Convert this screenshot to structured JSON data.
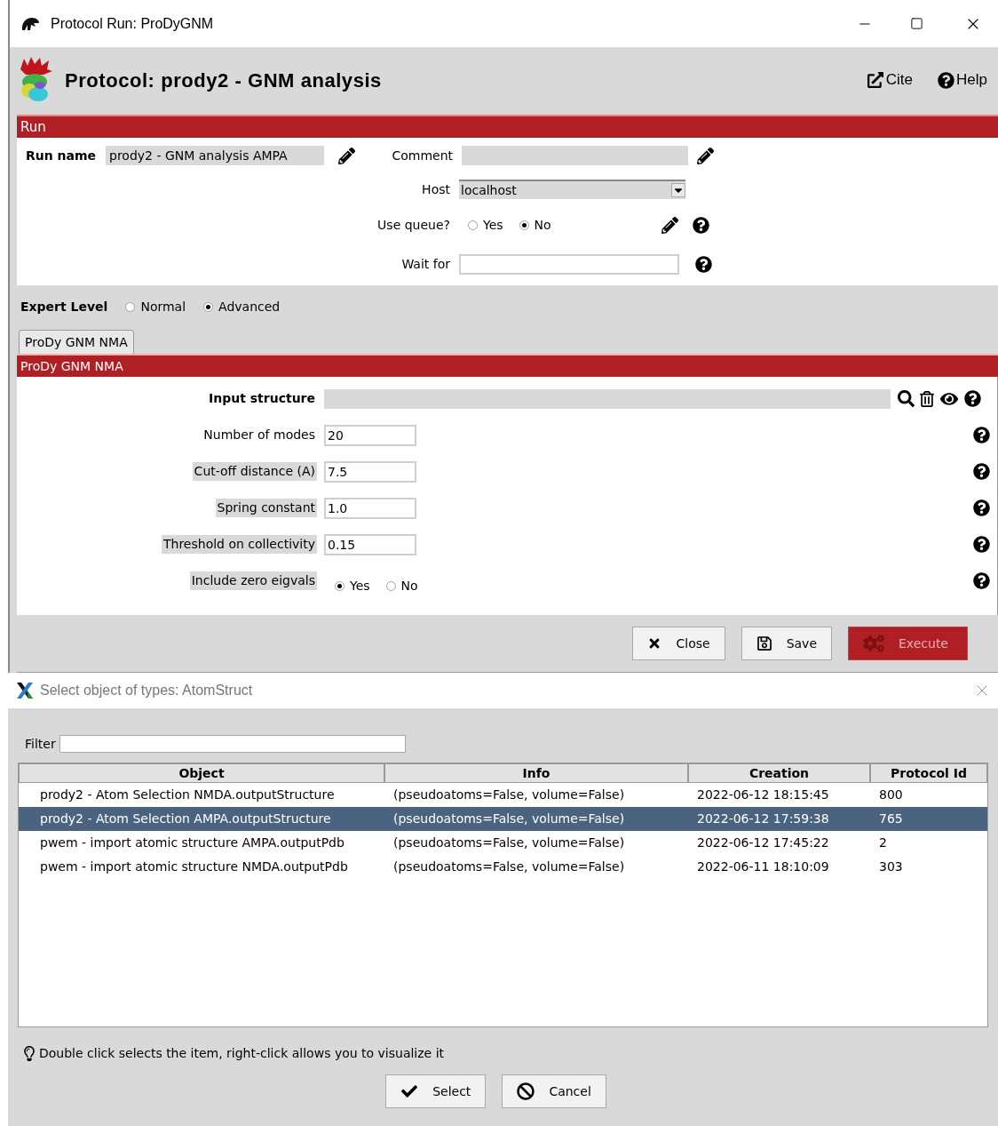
{
  "window": {
    "title": "Protocol Run: ProDyGNM"
  },
  "header": {
    "title": "Protocol: prody2 - GNM analysis",
    "links": [
      {
        "kind": "cite",
        "label": "Cite"
      },
      {
        "kind": "help",
        "label": "Help"
      }
    ]
  },
  "run_section": {
    "title": "Run",
    "run_name": {
      "label": "Run name",
      "value": "prody2 - GNM analysis AMPA"
    },
    "comment": {
      "label": "Comment"
    },
    "host": {
      "label": "Host",
      "value": "localhost"
    },
    "use_queue": {
      "label": "Use queue?",
      "options": [
        {
          "label": "Yes",
          "selected": false
        },
        {
          "label": "No",
          "selected": true
        }
      ]
    },
    "wait_for": {
      "label": "Wait for"
    }
  },
  "expert_level": {
    "label": "Expert Level",
    "options": [
      {
        "label": "Normal",
        "selected": false
      },
      {
        "label": "Advanced",
        "selected": true
      }
    ]
  },
  "tabs": [
    {
      "label": "ProDy GNM NMA",
      "selected": true
    }
  ],
  "section": {
    "title": "ProDy GNM NMA",
    "params": [
      {
        "kind": "structure",
        "label": "Input structure",
        "highlighted": false
      },
      {
        "kind": "text",
        "label": "Number of modes",
        "value": "20",
        "highlighted": false
      },
      {
        "kind": "text",
        "label": "Cut-off distance (A)",
        "value": "7.5",
        "highlighted": true
      },
      {
        "kind": "text",
        "label": "Spring constant",
        "value": "1.0",
        "highlighted": true
      },
      {
        "kind": "text",
        "label": "Threshold on collectivity",
        "value": "0.15",
        "highlighted": true
      },
      {
        "kind": "radio",
        "label": "Include zero eigvals",
        "highlighted": true,
        "options": [
          {
            "label": "Yes",
            "selected": true
          },
          {
            "label": "No",
            "selected": false
          }
        ]
      }
    ]
  },
  "buttons": [
    {
      "kind": "close",
      "label": "Close"
    },
    {
      "kind": "save",
      "label": "Save"
    },
    {
      "kind": "execute",
      "label": "Execute"
    }
  ],
  "dialog": {
    "title": "Select object of types: AtomStruct",
    "filter": {
      "label": "Filter"
    },
    "table": {
      "columns": [
        "Object",
        "Info",
        "Creation",
        "Protocol Id"
      ],
      "rows": [
        {
          "selected": false,
          "cells": [
            "prody2 - Atom Selection NMDA.outputStructure",
            "(pseudoatoms=False, volume=False)",
            "2022-06-12 18:15:45",
            "800"
          ]
        },
        {
          "selected": true,
          "cells": [
            "prody2 - Atom Selection AMPA.outputStructure",
            "(pseudoatoms=False, volume=False)",
            "2022-06-12 17:59:38",
            "765"
          ]
        },
        {
          "selected": false,
          "cells": [
            "pwem - import atomic structure AMPA.outputPdb",
            "(pseudoatoms=False, volume=False)",
            "2022-06-12 17:45:22",
            "2"
          ]
        },
        {
          "selected": false,
          "cells": [
            "pwem - import atomic structure NMDA.outputPdb",
            "(pseudoatoms=False, volume=False)",
            "2022-06-11 18:10:09",
            "303"
          ]
        }
      ]
    },
    "hint": "Double click selects the item, right-click allows you to visualize it",
    "buttons": [
      {
        "kind": "select",
        "label": "Select"
      },
      {
        "kind": "cancel",
        "label": "Cancel"
      }
    ]
  }
}
